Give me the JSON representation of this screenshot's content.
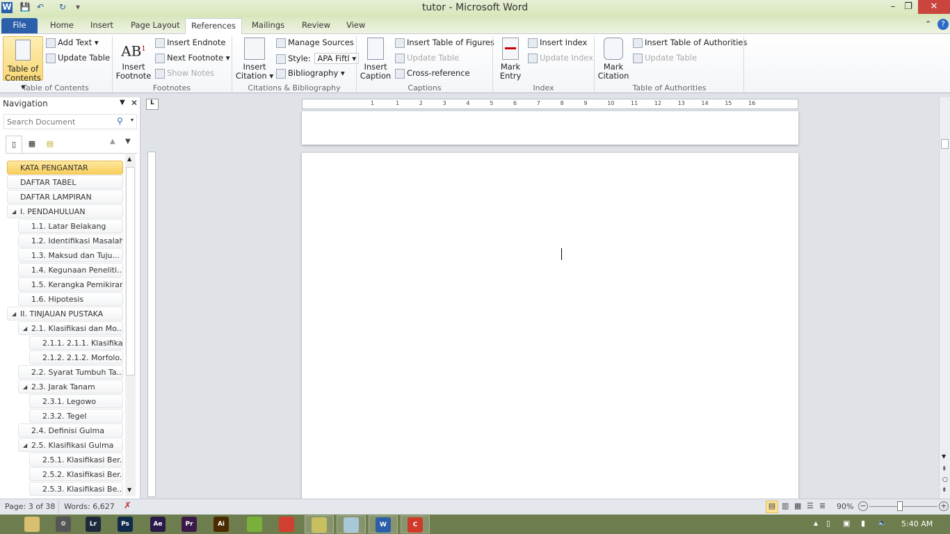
{
  "window": {
    "title": "tutor - Microsoft Word",
    "minimize": "–",
    "restore": "❐",
    "close": "✕"
  },
  "tabs": [
    "File",
    "Home",
    "Insert",
    "Page Layout",
    "References",
    "Mailings",
    "Review",
    "View"
  ],
  "ribbon": {
    "toc": {
      "big": "Table of Contents ▾",
      "add_text": "Add Text ▾",
      "update_table": "Update Table",
      "group": "Table of Contents"
    },
    "footnotes": {
      "insert_footnote": "Insert Footnote",
      "insert_endnote": "Insert Endnote",
      "next_footnote": "Next Footnote ▾",
      "show_notes": "Show Notes",
      "group": "Footnotes"
    },
    "citations": {
      "insert_citation": "Insert Citation ▾",
      "manage_sources": "Manage Sources",
      "style_label": "Style:",
      "style_value": "APA Fiftl",
      "bibliography": "Bibliography ▾",
      "group": "Citations & Bibliography"
    },
    "captions": {
      "insert_caption": "Insert Caption",
      "insert_tof": "Insert Table of Figures",
      "update_table": "Update Table",
      "cross_reference": "Cross-reference",
      "group": "Captions"
    },
    "index": {
      "mark_entry": "Mark Entry",
      "insert_index": "Insert Index",
      "update_index": "Update Index",
      "group": "Index"
    },
    "authorities": {
      "mark_citation": "Mark Citation",
      "insert_toa": "Insert Table of Authorities",
      "update_table": "Update Table",
      "group": "Table of Authorities"
    }
  },
  "navigation": {
    "title": "Navigation",
    "search_placeholder": "Search Document",
    "items": [
      {
        "label": "KATA PENGANTAR",
        "level": 0,
        "selected": true
      },
      {
        "label": "DAFTAR TABEL",
        "level": 0
      },
      {
        "label": "DAFTAR LAMPIRAN",
        "level": 0
      },
      {
        "label": "I. PENDAHULUAN",
        "level": 0,
        "expanded": true
      },
      {
        "label": "1.1.  Latar Belakang",
        "level": 1
      },
      {
        "label": "1.2.  Identifikasi Masalah",
        "level": 1
      },
      {
        "label": "1.3.  Maksud dan Tuju...",
        "level": 1
      },
      {
        "label": "1.4.  Kegunaan Peneliti...",
        "level": 1
      },
      {
        "label": "1.5.  Kerangka Pemikiran",
        "level": 1
      },
      {
        "label": "1.6.  Hipotesis",
        "level": 1
      },
      {
        "label": "II. TINJAUAN PUSTAKA",
        "level": 0,
        "expanded": true
      },
      {
        "label": "2.1.  Klasifikasi dan Mo...",
        "level": 1,
        "expanded": true
      },
      {
        "label": "2.1.1. 2.1.1. Klasifika...",
        "level": 2
      },
      {
        "label": "2.1.2. 2.1.2. Morfolo...",
        "level": 2
      },
      {
        "label": "2.2.  Syarat Tumbuh Ta...",
        "level": 1
      },
      {
        "label": "2.3. Jarak Tanam",
        "level": 1,
        "expanded": true
      },
      {
        "label": "2.3.1. Legowo",
        "level": 2
      },
      {
        "label": "2.3.2. Tegel",
        "level": 2
      },
      {
        "label": "2.4.  Definisi Gulma",
        "level": 1
      },
      {
        "label": "2.5.  Klasifikasi Gulma",
        "level": 1,
        "expanded": true
      },
      {
        "label": "2.5.1. Klasifikasi Ber...",
        "level": 2
      },
      {
        "label": "2.5.2. Klasifikasi Ber...",
        "level": 2
      },
      {
        "label": "2.5.3.  Klasifikasi Be...",
        "level": 2
      }
    ]
  },
  "ruler": {
    "labels": [
      "1",
      "1",
      "2",
      "3",
      "4",
      "5",
      "6",
      "7",
      "8",
      "9",
      "10",
      "11",
      "12",
      "13",
      "14",
      "15",
      "16"
    ]
  },
  "status": {
    "page": "Page: 3 of 38",
    "words": "Words: 6,627",
    "zoom": "90%"
  },
  "taskbar": {
    "apps": [
      {
        "label": "",
        "color": "#d8c070"
      },
      {
        "label": "⚙",
        "color": "#555"
      },
      {
        "label": "Lr",
        "color": "#1c2a3c"
      },
      {
        "label": "Ps",
        "color": "#0f2a4a"
      },
      {
        "label": "Ae",
        "color": "#2a1a4a"
      },
      {
        "label": "Pr",
        "color": "#3a1a4a"
      },
      {
        "label": "Ai",
        "color": "#4a2a00"
      },
      {
        "label": "",
        "color": "#7ab03a"
      },
      {
        "label": "",
        "color": "#d04030"
      },
      {
        "label": "",
        "color": "#c8c060"
      },
      {
        "label": "",
        "color": "#a8c8d8"
      },
      {
        "label": "W",
        "color": "#2b5faa"
      },
      {
        "label": "C",
        "color": "#d03a2a"
      }
    ],
    "clock": "5:40 AM"
  }
}
